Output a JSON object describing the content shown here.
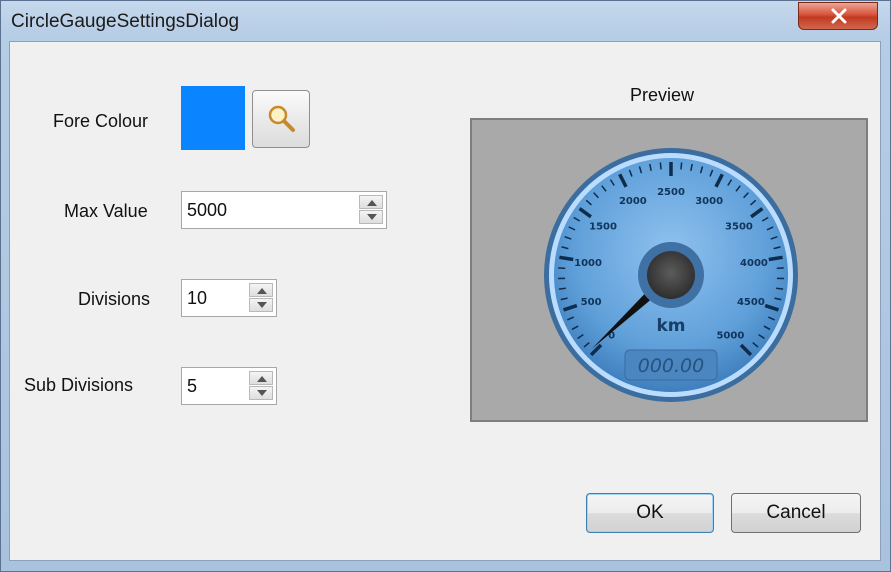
{
  "window": {
    "title": "CircleGaugeSettingsDialog",
    "close_glyph": "X"
  },
  "settings": {
    "fore_colour_label": "Fore Colour",
    "fore_colour_value": "#0a84ff",
    "max_value_label": "Max Value",
    "max_value": "5000",
    "divisions_label": "Divisions",
    "divisions": "10",
    "sub_divisions_label": "Sub Divisions",
    "sub_divisions": "5"
  },
  "preview": {
    "title": "Preview",
    "gauge": {
      "tick_labels": [
        "0",
        "500",
        "1000",
        "1500",
        "2000",
        "2500",
        "3000",
        "3500",
        "4000",
        "4500",
        "5000"
      ],
      "unit": "km",
      "odometer": "000.00"
    }
  },
  "buttons": {
    "ok": "OK",
    "cancel": "Cancel"
  }
}
